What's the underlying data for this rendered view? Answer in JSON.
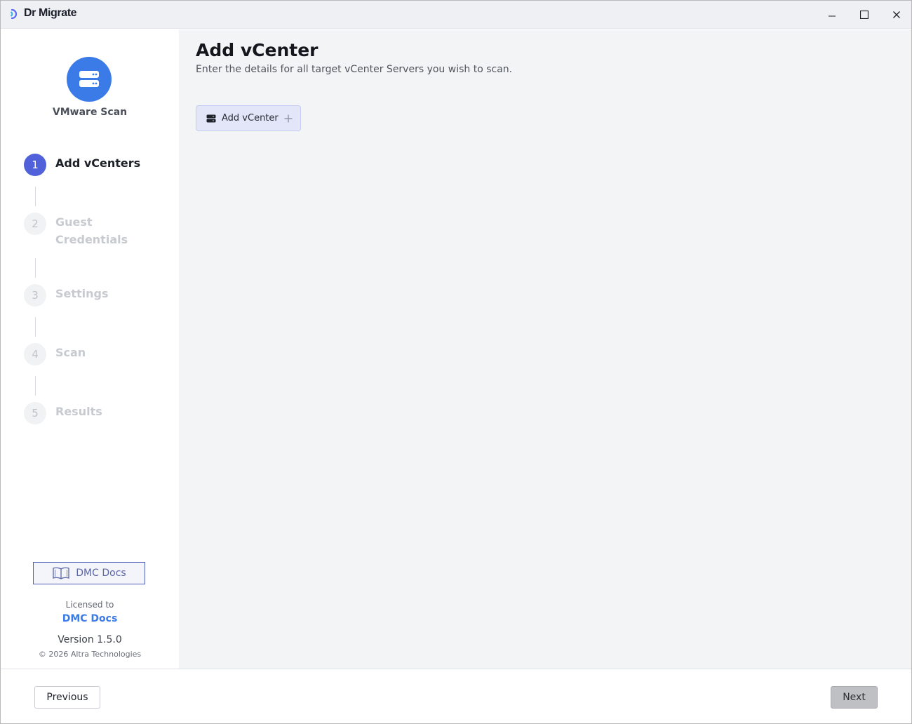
{
  "window": {
    "app_title": "Dr Migrate",
    "minimize_icon": "minimize-icon",
    "maximize_icon": "maximize-icon",
    "close_icon": "close-icon"
  },
  "sidebar": {
    "scan_icon": "server-icon",
    "scan_title": "VMware Scan",
    "steps": [
      {
        "number": "1",
        "label": "Add vCenters",
        "state": "active"
      },
      {
        "number": "2",
        "label": "Guest Credentials",
        "state": "inactive"
      },
      {
        "number": "3",
        "label": "Settings",
        "state": "inactive"
      },
      {
        "number": "4",
        "label": "Scan",
        "state": "inactive"
      },
      {
        "number": "5",
        "label": "Results",
        "state": "inactive"
      }
    ],
    "docs_button": {
      "label": "DMC Docs",
      "icon": "book-icon"
    },
    "licensed_to_label": "Licensed to",
    "licensee": "DMC Docs",
    "version": "Version 1.5.0",
    "copyright": "© 2026 Altra Technologies"
  },
  "main": {
    "title": "Add vCenter",
    "subtitle": "Enter the details for all target vCenter Servers you wish to scan.",
    "add_button": {
      "label": "Add vCenter",
      "icon": "server-icon",
      "trailing_icon": "plus-icon"
    }
  },
  "footer": {
    "previous_label": "Previous",
    "next_label": "Next"
  },
  "colors": {
    "accent": "#3a7be8",
    "step_active": "#5161d9",
    "main_background": "#f3f4f6"
  }
}
